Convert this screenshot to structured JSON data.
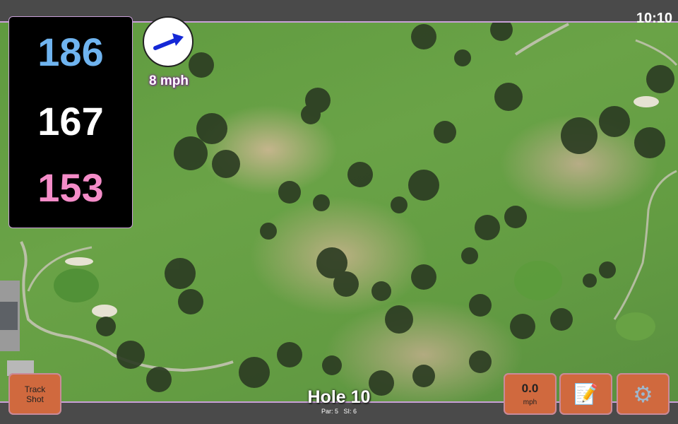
{
  "status": {
    "time": "10:10"
  },
  "distances": {
    "back": "186",
    "middle": "167",
    "front": "153"
  },
  "colors": {
    "back": "#6fb4f0",
    "middle": "#ffffff",
    "front": "#f48cc8",
    "button": "#d0693e",
    "arrow": "#1428d6"
  },
  "wind": {
    "speed_label": "8 mph",
    "icon": "wind-direction-arrow"
  },
  "hole": {
    "title": "Hole 10",
    "par": "Par: 5",
    "si": "SI: 6"
  },
  "buttons": {
    "track_shot": {
      "line1": "Track",
      "line2": "Shot"
    },
    "speed": {
      "value": "0.0",
      "unit": "mph"
    },
    "notes": {
      "icon": "notepad-icon",
      "glyph": "📝"
    },
    "settings": {
      "icon": "gear-icon",
      "glyph": "⚙"
    }
  }
}
